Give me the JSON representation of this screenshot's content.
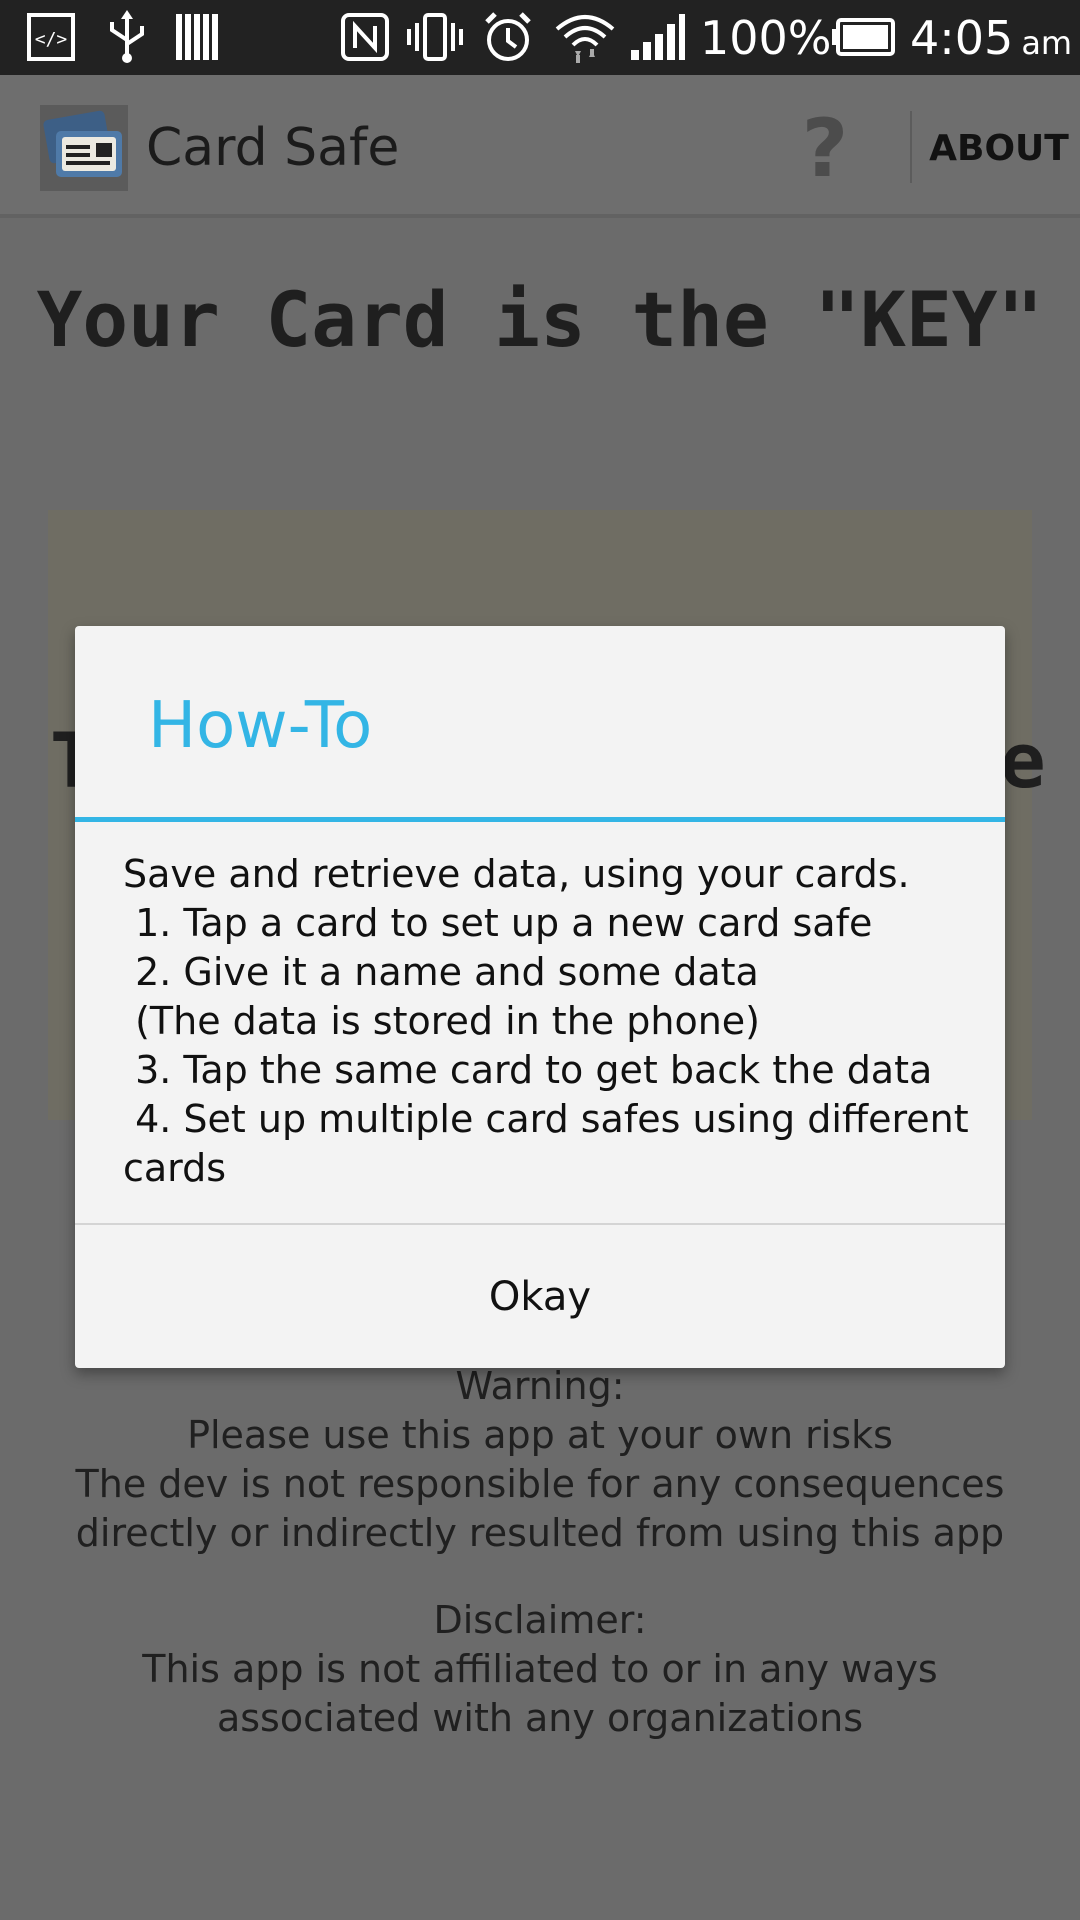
{
  "status_bar": {
    "battery": "100%",
    "time": "4:05",
    "time_suffix": "am",
    "icons": [
      "developer-icon",
      "usb-icon",
      "barcode-icon",
      "nfc-icon",
      "vibrate-icon",
      "alarm-icon",
      "wifi-icon",
      "signal-icon",
      "battery-icon"
    ]
  },
  "app_bar": {
    "title": "Card Safe",
    "help_label": "?",
    "about_label": "ABOUT"
  },
  "main": {
    "headline": "Your Card is the \"KEY\"",
    "card_text_left": "T",
    "card_text_right": "e",
    "warning_lines": [
      "Warning:",
      "Please use this app at your own risks",
      "The dev is not responsible for any consequences",
      "directly or indirectly resulted from using this app"
    ],
    "disclaimer_lines": [
      "Disclaimer:",
      "This app is not affiliated to or in any ways",
      "associated with any organizations"
    ]
  },
  "dialog": {
    "title": "How-To",
    "body_lines": [
      "Save and retrieve data, using your cards.",
      " 1. Tap a card to set up a new card safe",
      " 2. Give it a name and some data",
      " (The data is stored in the phone)",
      " 3. Tap the same card to get back the data",
      " 4. Set up multiple card safes using different",
      "cards"
    ],
    "okay_label": "Okay"
  },
  "colors": {
    "accent": "#33b5e5",
    "dim_background": "#6b6b6b",
    "dialog_background": "#f3f3f3"
  }
}
